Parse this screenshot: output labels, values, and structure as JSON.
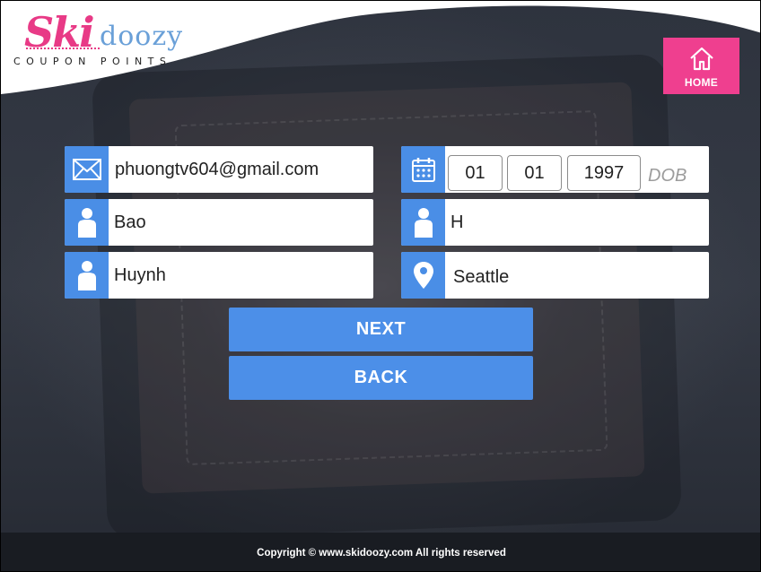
{
  "brand": {
    "logo_primary": "Ski",
    "logo_secondary": "doozy",
    "logo_subtitle": "COUPON POINTS",
    "colors": {
      "pink": "#ef3f8f",
      "blue": "#4a8ee6"
    }
  },
  "header": {
    "home_label": "HOME",
    "home_icon": "home-icon"
  },
  "form": {
    "email": {
      "value": "phuongtv604@gmail.com",
      "icon": "envelope-icon"
    },
    "first_name": {
      "value": "Bao",
      "icon": "person-icon"
    },
    "last_name": {
      "value": "Huynh",
      "icon": "person-icon"
    },
    "dob": {
      "icon": "calendar-icon",
      "month": "01",
      "day": "01",
      "year": "1997",
      "placeholder": "DOB"
    },
    "middle_initial": {
      "value": "H",
      "icon": "person-icon"
    },
    "city": {
      "value": "Seattle",
      "icon": "location-pin-icon"
    }
  },
  "buttons": {
    "next": "NEXT",
    "back": "BACK"
  },
  "footer": {
    "copyright": "Copyright © www.skidoozy.com All rights reserved"
  }
}
